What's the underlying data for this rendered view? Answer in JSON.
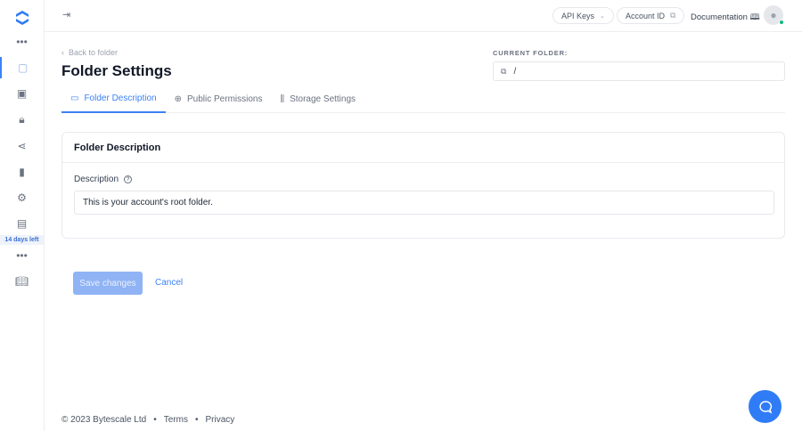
{
  "sidebar": {
    "trial_badge": "14 days left"
  },
  "topbar": {
    "api_keys": "API Keys",
    "account_id": "Account ID",
    "documentation": "Documentation"
  },
  "page": {
    "back_link": "Back to folder",
    "title": "Folder Settings",
    "current_folder_label": "CURRENT FOLDER:",
    "current_folder_value": "/"
  },
  "tabs": [
    {
      "label": "Folder Description"
    },
    {
      "label": "Public Permissions"
    },
    {
      "label": "Storage Settings"
    }
  ],
  "card": {
    "title": "Folder Description",
    "field_label": "Description",
    "field_value": "This is your account's root folder."
  },
  "actions": {
    "save": "Save changes",
    "cancel": "Cancel"
  },
  "footer": {
    "copyright": "© 2023 Bytescale Ltd",
    "terms": "Terms",
    "privacy": "Privacy"
  },
  "colors": {
    "accent": "#3b82f6",
    "save_disabled": "#8fb3f5",
    "logo": "#2f7cf6"
  }
}
